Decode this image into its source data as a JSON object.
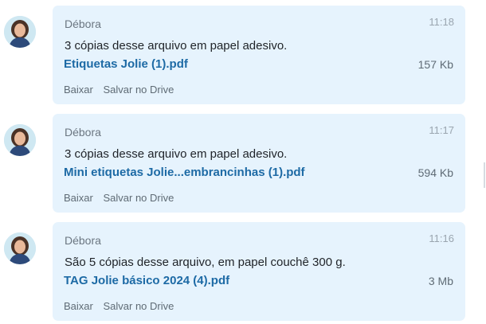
{
  "messages": [
    {
      "sender": "Débora",
      "time": "11:18",
      "text": "3 cópias desse arquivo em papel adesivo.",
      "file": {
        "name": "Etiquetas Jolie (1).pdf",
        "size": "157 Kb"
      },
      "actions": {
        "download": "Baixar",
        "save_drive": "Salvar no Drive"
      }
    },
    {
      "sender": "Débora",
      "time": "11:17",
      "text": "3 cópias desse arquivo em papel adesivo.",
      "file": {
        "name": "Mini etiquetas Jolie...embrancinhas (1).pdf",
        "size": "594 Kb"
      },
      "actions": {
        "download": "Baixar",
        "save_drive": "Salvar no Drive"
      }
    },
    {
      "sender": "Débora",
      "time": "11:16",
      "text": "São 5 cópias desse arquivo, em papel couchê 300 g.",
      "file": {
        "name": "TAG Jolie básico 2024 (4).pdf",
        "size": "3 Mb"
      },
      "actions": {
        "download": "Baixar",
        "save_drive": "Salvar no Drive"
      }
    }
  ],
  "colors": {
    "bubble_bg": "#e6f3fd",
    "file_link": "#1d6aa5",
    "sender": "#6b7681"
  },
  "icons": {
    "avatar": "user-photo-avatar"
  }
}
